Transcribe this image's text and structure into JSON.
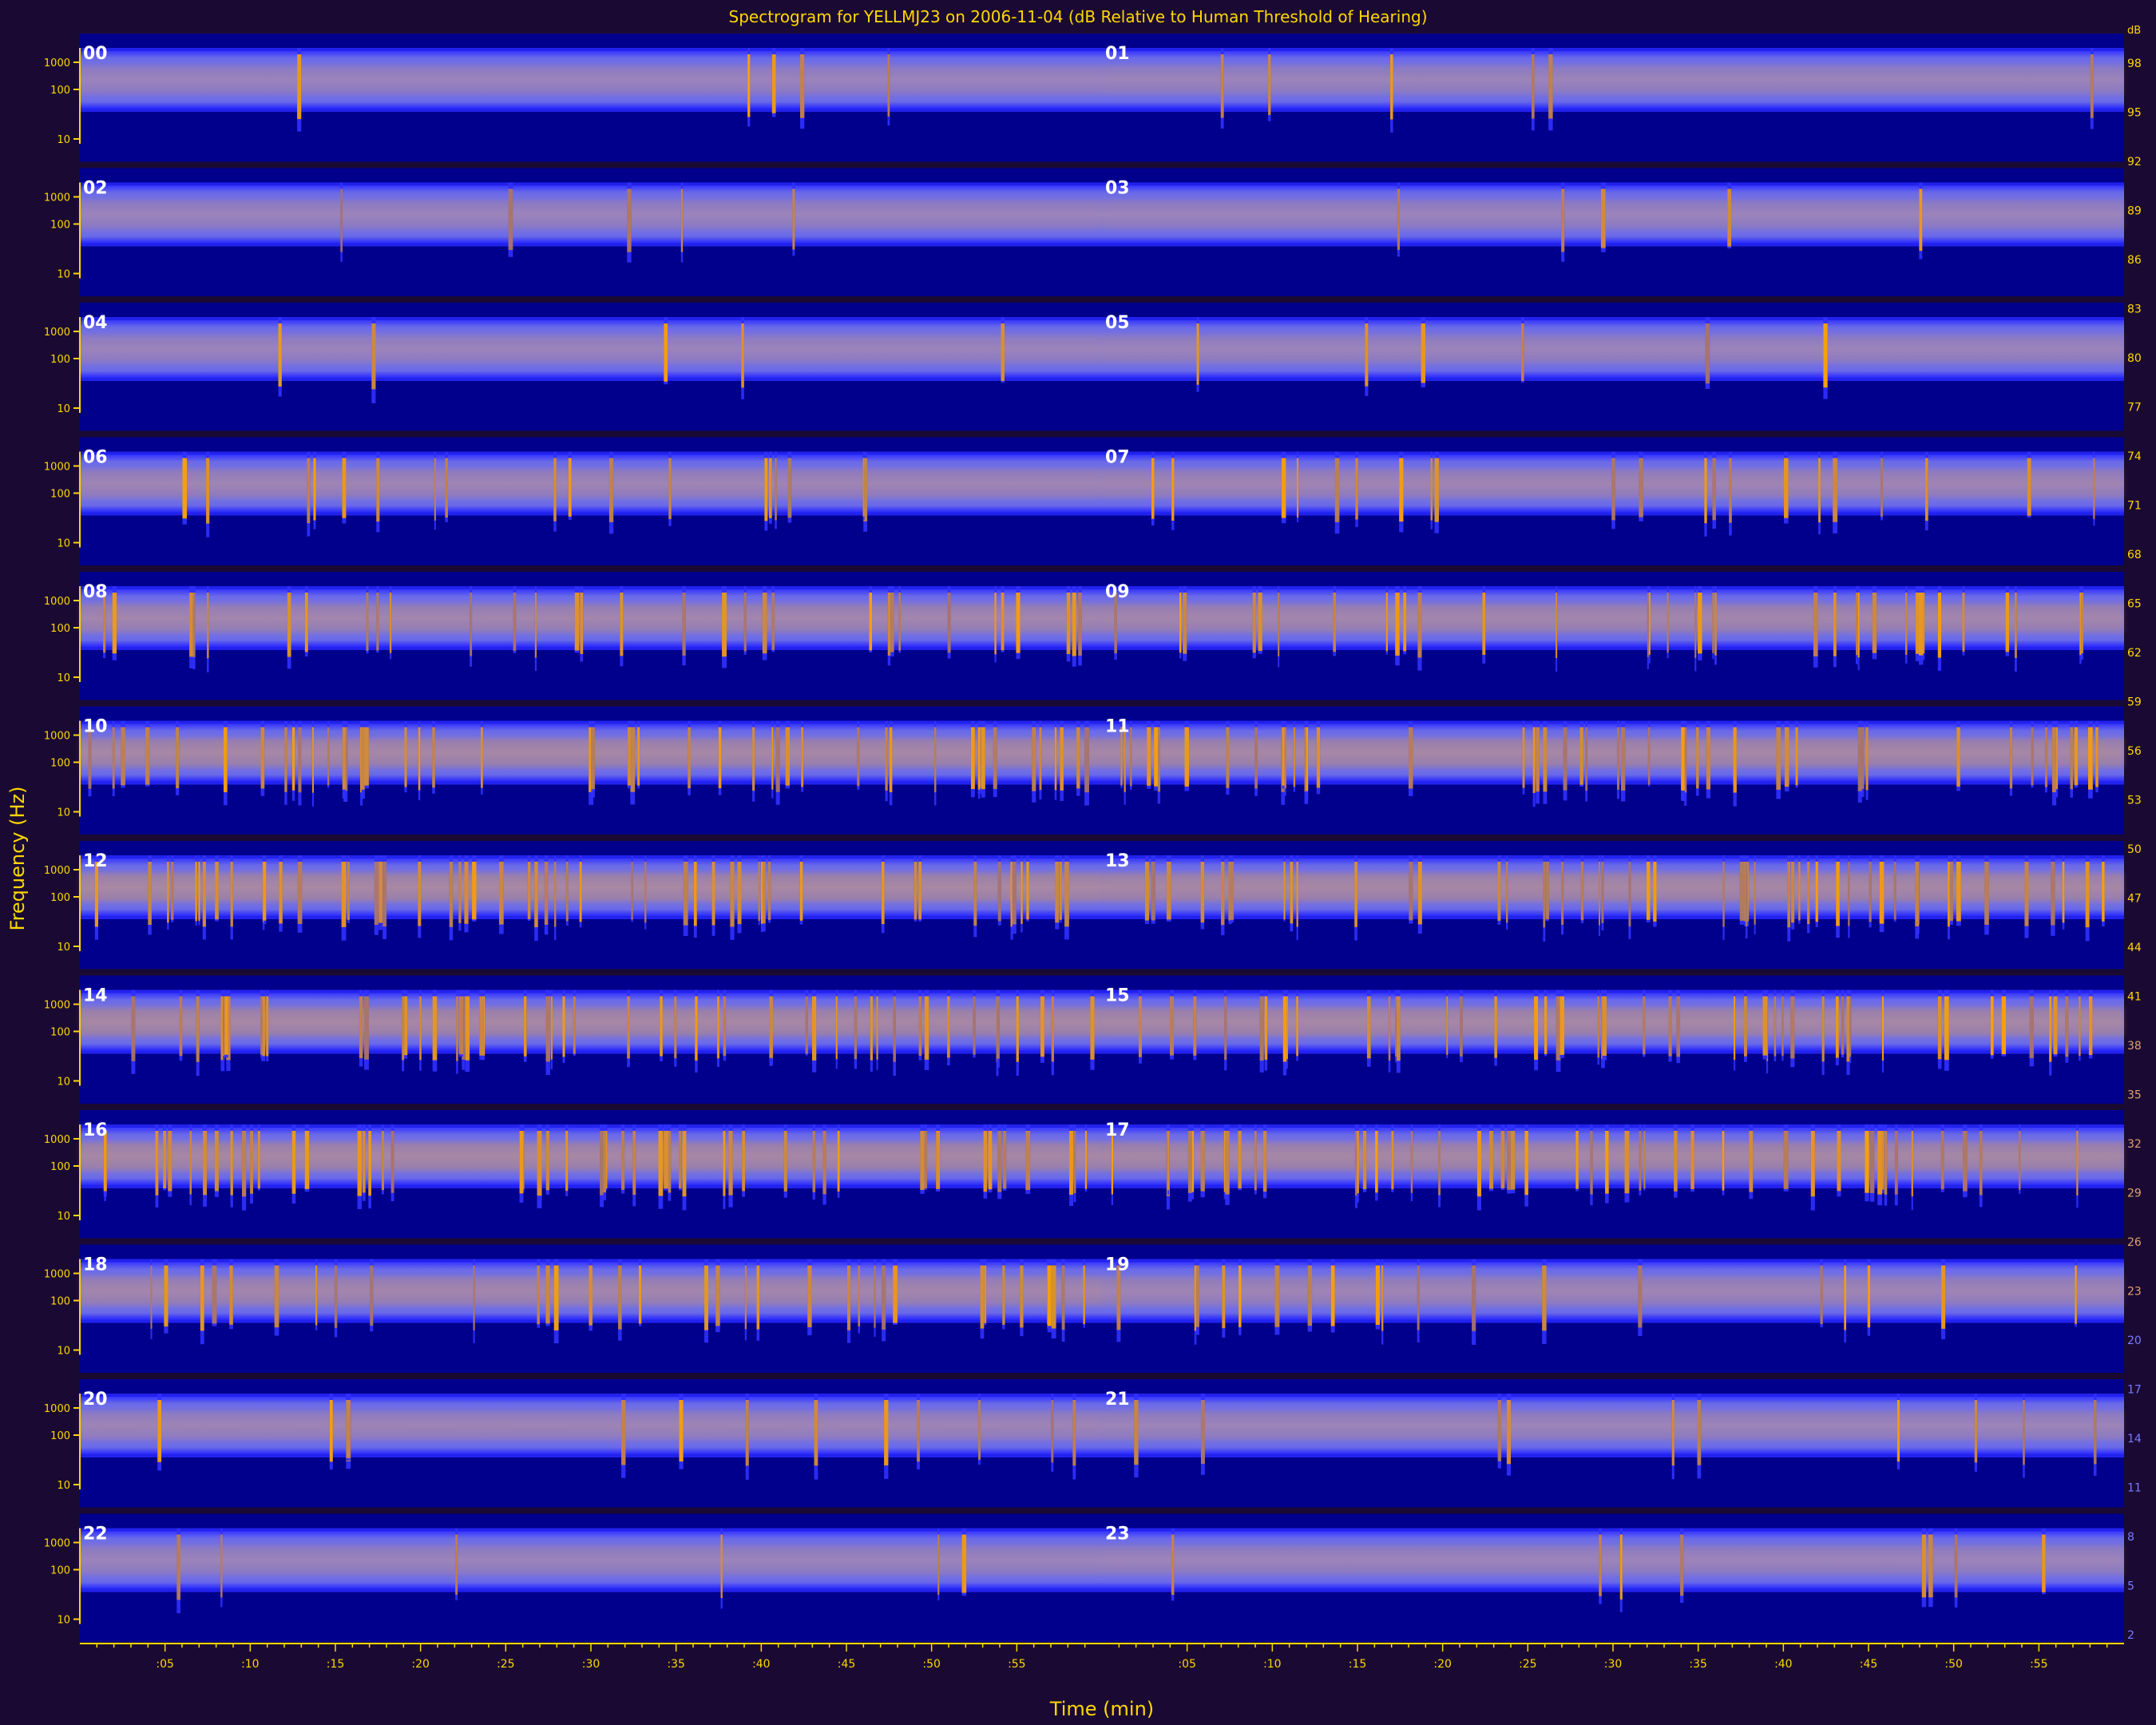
{
  "chart_data": {
    "type": "heatmap",
    "title": "Spectrogram for YELLMJ23 on 2006-11-04 (dB Relative to Human Threshold of Hearing)",
    "xlabel": "Time (min)",
    "ylabel": "Frequency (Hz)",
    "x_ticks": [
      ":05",
      ":10",
      ":15",
      ":20",
      ":25",
      ":30",
      ":35",
      ":40",
      ":45",
      ":50",
      ":55"
    ],
    "y_ticks": [
      "1000",
      "100",
      "10"
    ],
    "hours": [
      "00",
      "01",
      "02",
      "03",
      "04",
      "05",
      "06",
      "07",
      "08",
      "09",
      "10",
      "11",
      "12",
      "13",
      "14",
      "15",
      "16",
      "17",
      "18",
      "19",
      "20",
      "21",
      "22",
      "23"
    ],
    "colorbar": {
      "label": "dB",
      "values": [
        98,
        95,
        92,
        89,
        86,
        83,
        80,
        77,
        74,
        71,
        68,
        65,
        62,
        59,
        56,
        53,
        50,
        47,
        44,
        41,
        38,
        35,
        32,
        29,
        26,
        23,
        20,
        17,
        14,
        11,
        8,
        5,
        2
      ]
    },
    "activity": [
      0.05,
      0.08,
      0.06,
      0.05,
      0.05,
      0.08,
      0.3,
      0.35,
      0.55,
      0.6,
      0.85,
      0.85,
      0.95,
      0.9,
      0.9,
      0.85,
      0.9,
      0.85,
      0.6,
      0.3,
      0.2,
      0.15,
      0.08,
      0.1
    ],
    "colors": {
      "background": "#1a0a33",
      "field": "#00008c",
      "band": "#5c5ce6",
      "burst": "#ffa500",
      "text": "#ffd700"
    }
  }
}
